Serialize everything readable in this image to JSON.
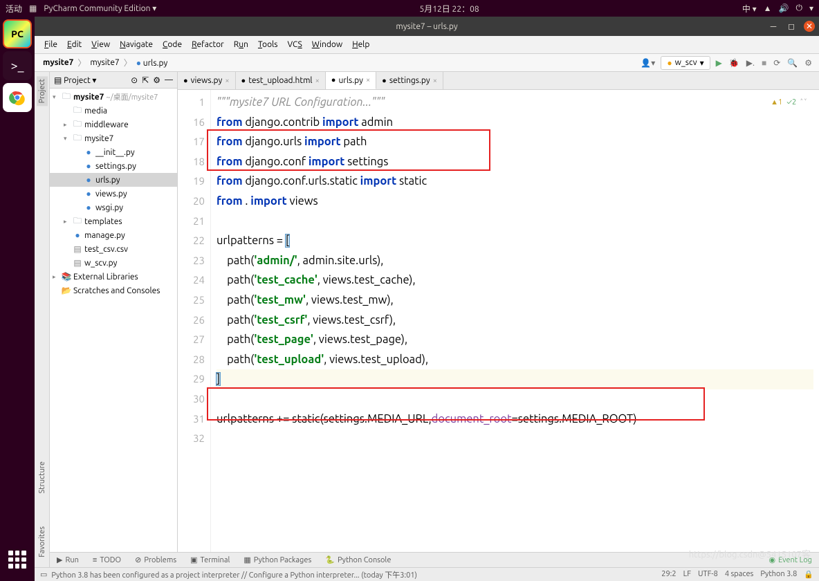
{
  "ubuntu": {
    "activities": "活动",
    "app_name": "PyCharm Community Edition",
    "datetime": "5月12日 22：08",
    "lang": "中 ▾"
  },
  "titlebar": {
    "title": "mysite7 – urls.py"
  },
  "menubar": [
    "File",
    "Edit",
    "View",
    "Navigate",
    "Code",
    "Refactor",
    "Run",
    "Tools",
    "VCS",
    "Window",
    "Help"
  ],
  "breadcrumbs": [
    "mysite7",
    "mysite7",
    "urls.py"
  ],
  "branch": "w_scv",
  "project_header": "Project",
  "tree": [
    {
      "depth": 0,
      "icon": "folder",
      "arrow": "▾",
      "label": "mysite7",
      "suffix": "~/桌面/mysite7",
      "bold": true
    },
    {
      "depth": 1,
      "icon": "folder",
      "arrow": "",
      "label": "media"
    },
    {
      "depth": 1,
      "icon": "folder",
      "arrow": "▸",
      "label": "middleware"
    },
    {
      "depth": 1,
      "icon": "folder",
      "arrow": "▾",
      "label": "mysite7"
    },
    {
      "depth": 2,
      "icon": "py",
      "arrow": "",
      "label": "__init__.py"
    },
    {
      "depth": 2,
      "icon": "py",
      "arrow": "",
      "label": "settings.py"
    },
    {
      "depth": 2,
      "icon": "py",
      "arrow": "",
      "label": "urls.py",
      "selected": true
    },
    {
      "depth": 2,
      "icon": "py",
      "arrow": "",
      "label": "views.py"
    },
    {
      "depth": 2,
      "icon": "py",
      "arrow": "",
      "label": "wsgi.py"
    },
    {
      "depth": 1,
      "icon": "folder",
      "arrow": "▸",
      "label": "templates"
    },
    {
      "depth": 1,
      "icon": "py",
      "arrow": "",
      "label": "manage.py"
    },
    {
      "depth": 1,
      "icon": "csv",
      "arrow": "",
      "label": "test_csv.csv"
    },
    {
      "depth": 1,
      "icon": "csv",
      "arrow": "",
      "label": "w_scv.py"
    },
    {
      "depth": 0,
      "icon": "lib",
      "arrow": "▸",
      "label": "External Libraries"
    },
    {
      "depth": 0,
      "icon": "scratch",
      "arrow": "",
      "label": "Scratches and Consoles"
    }
  ],
  "tabs": [
    {
      "label": "views.py",
      "icon": "py"
    },
    {
      "label": "test_upload.html",
      "icon": "html"
    },
    {
      "label": "urls.py",
      "icon": "py",
      "active": true
    },
    {
      "label": "settings.py",
      "icon": "py"
    }
  ],
  "code": {
    "first_line": 1,
    "line_numbers": [
      1,
      16,
      17,
      18,
      19,
      20,
      21,
      22,
      23,
      24,
      25,
      26,
      27,
      28,
      29,
      30,
      31,
      32
    ],
    "doc": "\"\"\"mysite7 URL Configuration...\"\"\"",
    "l16": {
      "pre": "from",
      "mod": " django.contrib ",
      "imp": "import",
      "post": " admin"
    },
    "l17": {
      "pre": "from",
      "mod": " django.urls ",
      "imp": "import",
      "post": " path"
    },
    "l18": {
      "pre": "from",
      "mod": " django.conf ",
      "imp": "import",
      "post": " settings"
    },
    "l19": {
      "pre": "from",
      "mod": " django.conf.urls.static ",
      "imp": "import",
      "post": " static"
    },
    "l20_a": "from",
    "l20_b": " . ",
    "l20_c": "import",
    "l20_d": " views",
    "l22": "urlpatterns = ",
    "paths": [
      {
        "fn": "    path(",
        "s": "'admin/'",
        "rest": ", admin.site.urls),"
      },
      {
        "fn": "    path(",
        "s": "'test_cache'",
        "rest": ", views.test_cache),"
      },
      {
        "fn": "    path(",
        "s": "'test_mw'",
        "rest": ", views.test_mw),"
      },
      {
        "fn": "    path(",
        "s": "'test_csrf'",
        "rest": ", views.test_csrf),"
      },
      {
        "fn": "    path(",
        "s": "'test_page'",
        "rest": ", views.test_page),"
      },
      {
        "fn": "    path(",
        "s": "'test_upload'",
        "rest": ", views.test_upload),"
      }
    ],
    "l31_a": "urlpatterns += static(settings.MEDIA_URL,",
    "l31_param": "document_root",
    "l31_b": "=settings.MEDIA_ROOT)"
  },
  "inspections": {
    "warn": "1",
    "ok": "2"
  },
  "side_tabs": [
    "Project",
    "Structure",
    "Favorites"
  ],
  "bottom_tabs": [
    "Run",
    "TODO",
    "Problems",
    "Terminal",
    "Python Packages",
    "Python Console"
  ],
  "event_log": "Event Log",
  "status": {
    "msg": "Python 3.8 has been configured as a project interpreter // Configure a Python interpreter... (today 下午3:01)",
    "pos": "29:2",
    "lf": "LF",
    "enc": "UTF-8",
    "indent": "4 spaces",
    "sdk": "Python 3.8"
  },
  "watermark": "https://blog.csdn@5415107客"
}
